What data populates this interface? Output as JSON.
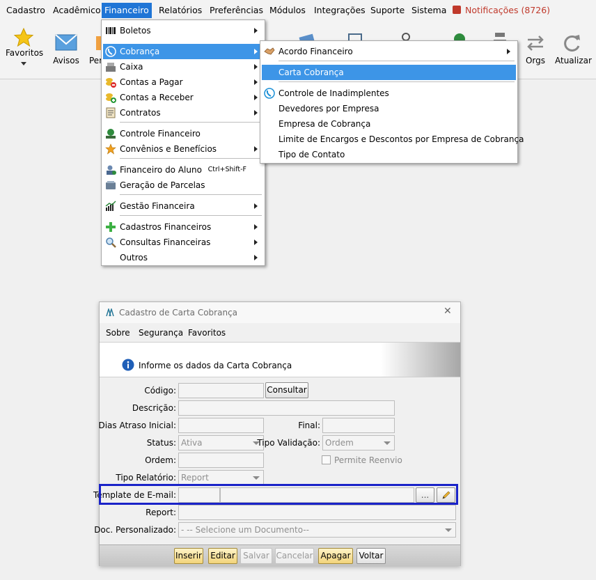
{
  "menubar": {
    "items": [
      "Cadastro",
      "Acadêmico",
      "Financeiro",
      "Relatórios",
      "Preferências",
      "Módulos",
      "Integrações",
      "Suporte",
      "Sistema"
    ],
    "notifications": "Notificações (8726)"
  },
  "toolbar": {
    "favoritos": "Favoritos",
    "avisos": "Avisos",
    "per": "Per",
    "orgs": "Orgs",
    "atualizar": "Atualizar"
  },
  "financeiro_menu": {
    "items": [
      {
        "label": "Boletos",
        "icon": "barcode-icon"
      },
      {
        "label": "Cobrança",
        "icon": "phone-icon"
      },
      {
        "label": "Caixa",
        "icon": "register-icon"
      },
      {
        "label": "Contas a Pagar",
        "icon": "coins-minus-icon"
      },
      {
        "label": "Contas a Receber",
        "icon": "coins-plus-icon"
      },
      {
        "label": "Contratos",
        "icon": "contract-icon"
      },
      {
        "label": "Controle Financeiro",
        "icon": "money-icon"
      },
      {
        "label": "Convênios e Benefícios",
        "icon": "star-icon"
      },
      {
        "label": "Financeiro do Aluno",
        "icon": "student-icon",
        "shortcut": "Ctrl+Shift-F"
      },
      {
        "label": "Geração de Parcelas",
        "icon": "installments-icon"
      },
      {
        "label": "Gestão Financeira",
        "icon": "chart-icon"
      },
      {
        "label": "Cadastros Financeiros",
        "icon": "plus-icon"
      },
      {
        "label": "Consultas Financeiras",
        "icon": "magnifier-icon"
      },
      {
        "label": "Outros",
        "icon": ""
      }
    ]
  },
  "cobranca_menu": {
    "items": [
      {
        "label": "Acordo Financeiro",
        "icon": "handshake-icon"
      },
      {
        "label": "Carta Cobrança",
        "icon": ""
      },
      {
        "label": "Controle de Inadimplentes",
        "icon": "phone-icon"
      },
      {
        "label": "Devedores por Empresa",
        "icon": ""
      },
      {
        "label": "Empresa de Cobrança",
        "icon": ""
      },
      {
        "label": "Limite de Encargos e Descontos por Empresa de Cobrança",
        "icon": ""
      },
      {
        "label": "Tipo de Contato",
        "icon": ""
      }
    ]
  },
  "dialog": {
    "title": "Cadastro de Carta Cobrança",
    "menu": [
      "Sobre",
      "Segurança",
      "Favoritos"
    ],
    "info": "Informe os dados da Carta Cobrança",
    "labels": {
      "codigo": "Código:",
      "descricao": "Descrição:",
      "dias_atraso": "Dias Atraso Inicial:",
      "final": "Final:",
      "status": "Status:",
      "tipo_validacao": "Tipo Validação:",
      "ordem": "Ordem:",
      "permite_reenvio": "Permite Reenvio",
      "tipo_relatorio": "Tipo Relatório:",
      "template_email": "Template de E-mail:",
      "report": "Report:",
      "doc_personalizado": "Doc. Personalizado:"
    },
    "values": {
      "status": "Ativa",
      "tipo_validacao": "Ordem",
      "tipo_relatorio": "Report",
      "doc_personalizado": "- -- Selecione um Documento--",
      "ellipsis": "..."
    },
    "buttons": {
      "consultar": "Consultar",
      "inserir": "Inserir",
      "editar": "Editar",
      "salvar": "Salvar",
      "cancelar": "Cancelar",
      "apagar": "Apagar",
      "voltar": "Voltar"
    }
  }
}
